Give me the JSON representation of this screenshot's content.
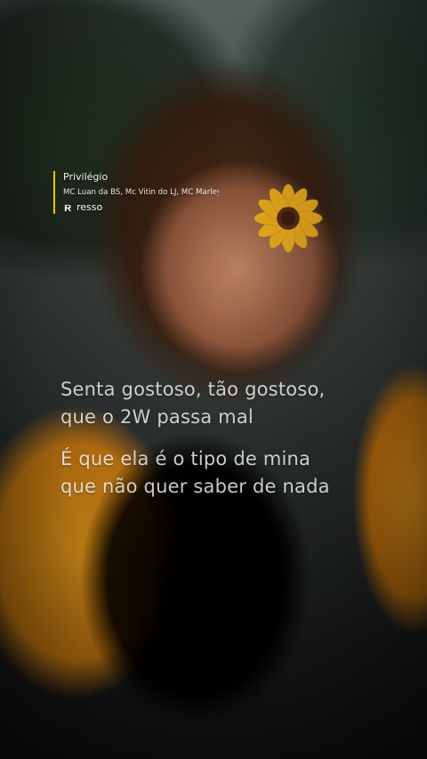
{
  "track": {
    "title": "Privilégio",
    "artists": "MC Luan da BS, Mc Vitin do LJ, MC Marley",
    "brand": "resso",
    "icons": {
      "brand": "resso-logo-icon"
    },
    "accent": "#f2c200"
  },
  "lyrics": {
    "verses": [
      {
        "lines": [
          "Senta gostoso, tão gostoso,",
          "que o 2W passa mal"
        ]
      },
      {
        "lines": [
          "É que ela é o tipo de mina",
          "que não quer saber de nada"
        ]
      }
    ]
  },
  "background": {
    "scene": "photo"
  }
}
